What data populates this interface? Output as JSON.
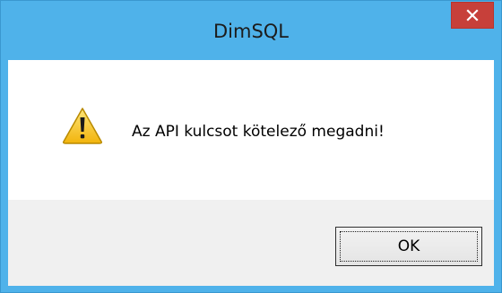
{
  "window": {
    "title": "DimSQL",
    "close_icon": "close-icon"
  },
  "dialog": {
    "icon": "warning-icon",
    "message": "Az API kulcsot kötelező megadni!",
    "ok_label": "OK"
  },
  "colors": {
    "frame": "#4fb2ea",
    "close": "#c7403a",
    "button_area": "#f0f0f0",
    "warning_yellow": "#f5c518"
  }
}
